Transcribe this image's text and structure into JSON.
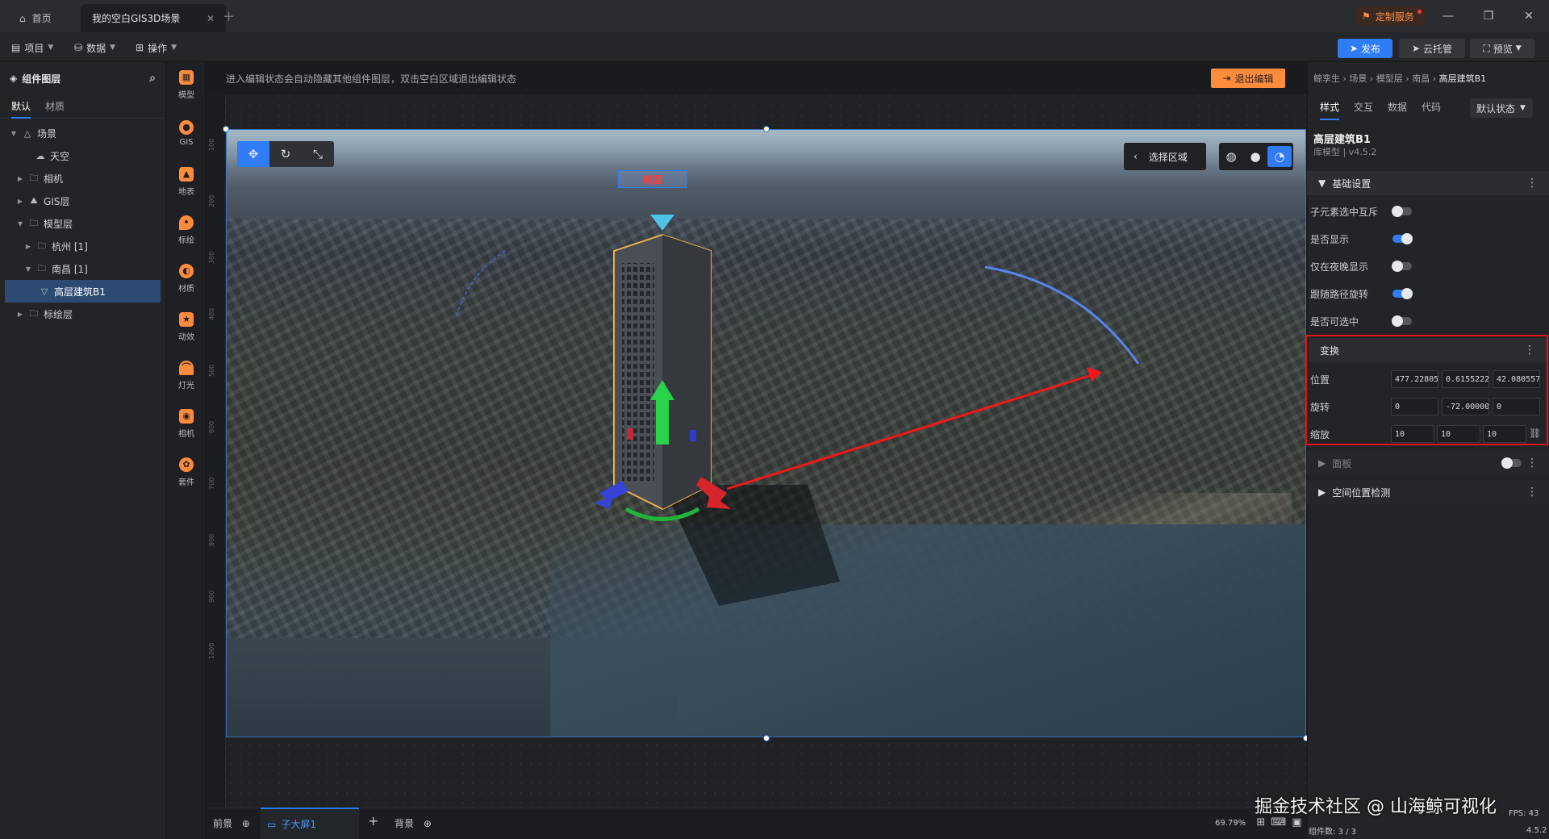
{
  "titlebar": {
    "tabs": [
      {
        "label": "首页"
      },
      {
        "label": "我的空白GIS3D场景"
      }
    ],
    "service_button": "定制服务"
  },
  "toolbar": {
    "menus": [
      {
        "label": "项目"
      },
      {
        "label": "数据"
      },
      {
        "label": "操作"
      }
    ],
    "publish": "发布",
    "cloud": "云托管",
    "preview": "预览"
  },
  "layer_panel": {
    "title": "组件图层",
    "tabs": [
      "默认",
      "材质"
    ],
    "tree": [
      {
        "label": "场景",
        "icon": "scene-icon",
        "expanded": true
      },
      {
        "label": "天空",
        "icon": "sky-icon"
      },
      {
        "label": "相机",
        "icon": "folder-icon"
      },
      {
        "label": "GIS层",
        "icon": "gis-icon"
      },
      {
        "label": "模型层",
        "icon": "folder-icon",
        "expanded": true
      },
      {
        "label": "杭州 [1]",
        "icon": "folder-icon"
      },
      {
        "label": "南昌 [1]",
        "icon": "folder-icon",
        "expanded": true
      },
      {
        "label": "高层建筑B1",
        "icon": "model-icon",
        "selected": true
      },
      {
        "label": "标绘层",
        "icon": "folder-icon"
      }
    ]
  },
  "rail": [
    {
      "label": "模型"
    },
    {
      "label": "GIS"
    },
    {
      "label": "地表"
    },
    {
      "label": "标绘"
    },
    {
      "label": "材质"
    },
    {
      "label": "动效"
    },
    {
      "label": "灯光"
    },
    {
      "label": "相机"
    },
    {
      "label": "套件"
    }
  ],
  "canvas": {
    "hint": "进入编辑状态会自动隐藏其他组件图层，双击空白区域退出编辑状态",
    "exit_button": "退出编辑",
    "area_select": "选择区域",
    "city_label": "南昌",
    "ruler_ticks": [
      "100",
      "200",
      "300",
      "400",
      "500",
      "600",
      "700",
      "800",
      "900",
      "1000"
    ]
  },
  "bottom": {
    "foreground": "前景",
    "sub_screen": "子大屏1",
    "background": "背景",
    "zoom": "69.79%"
  },
  "props": {
    "breadcrumb": [
      "鲸孪生",
      "场景",
      "模型层",
      "南昌",
      "高层建筑B1"
    ],
    "tabs": [
      "样式",
      "交互",
      "数据",
      "代码"
    ],
    "state": "默认状态",
    "name": "高层建筑B1",
    "subtitle": "库模型 | v4.5.2",
    "basic_section": "基础设置",
    "toggles": [
      {
        "label": "子元素选中互斥",
        "on": false
      },
      {
        "label": "是否显示",
        "on": true
      },
      {
        "label": "仅在夜晚显示",
        "on": false
      },
      {
        "label": "跟随路径旋转",
        "on": true
      },
      {
        "label": "是否可选中",
        "on": false
      }
    ],
    "transform_section": "变换",
    "position_label": "位置",
    "position": [
      "477.22805",
      "0.6155222",
      "42.080557"
    ],
    "rotation_label": "旋转",
    "rotation": [
      "0",
      "-72.00000",
      "0"
    ],
    "scale_label": "缩放",
    "scale": [
      "10",
      "10",
      "10"
    ],
    "panel_section": "面板",
    "spatial_section": "空间位置检测"
  },
  "footer": {
    "component_count": "组件数: 3 / 3",
    "version": "4.5.2",
    "fps": "FPS: 43"
  },
  "watermark": "掘金技术社区 @ 山海鲸可视化",
  "colors": {
    "accent": "#2f7cf6",
    "orange": "#ff8b3d",
    "highlight_box": "#e0161c"
  }
}
